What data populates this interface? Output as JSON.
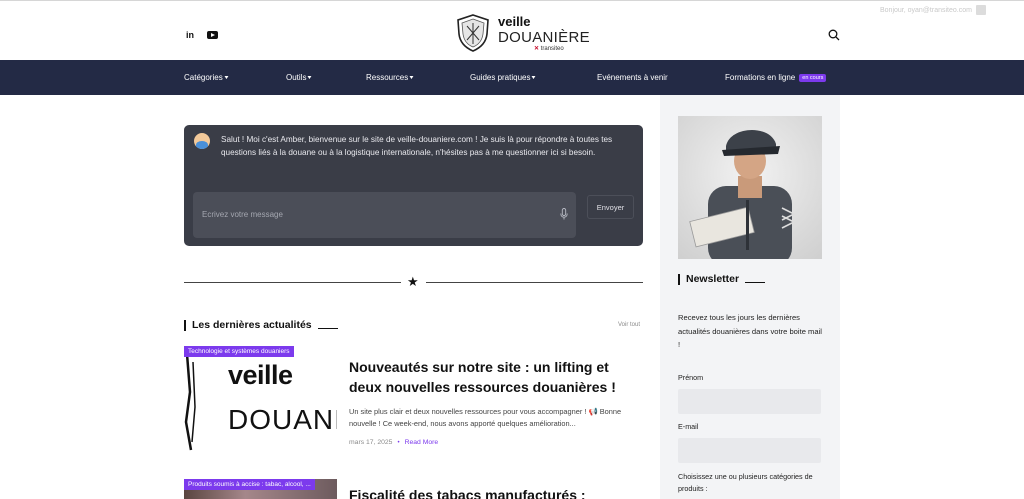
{
  "topbar": {
    "social_icons": [
      "linkedin-icon",
      "youtube-icon"
    ],
    "linkedin_glyph": "in",
    "logo": {
      "word1": "veille",
      "word2": "DOUANIÈRE",
      "by": "transiteo"
    },
    "user_hint": "Bonjour, oyan@transiteo.com"
  },
  "nav": {
    "items": [
      {
        "label": "Catégories",
        "chevron": "▾"
      },
      {
        "label": "Outils",
        "chevron": "▾"
      },
      {
        "label": "Ressources",
        "chevron": "▾"
      },
      {
        "label": "Guides pratiques",
        "chevron": "▾"
      },
      {
        "label": "Evénements à venir"
      },
      {
        "label": "Formations en ligne",
        "badge": "en cours"
      }
    ]
  },
  "chat": {
    "message": "Salut ! Moi c'est Amber, bienvenue sur le site de veille-douaniere.com ! Je suis là pour répondre à toutes tes questions liés à la douane ou à la logistique internationale, n'hésites pas à me questionner ici si besoin.",
    "input_placeholder": "Ecrivez votre message",
    "send_label": "Envoyer"
  },
  "news": {
    "section_title": "Les dernières actualités",
    "see_all": "Voir tout",
    "articles": [
      {
        "category": "Technologie et systèmes douaniers",
        "thumb_word1": "veille",
        "thumb_word2": "DOUANIÈRE",
        "title": "Nouveautés sur notre site : un lifting et deux nouvelles ressources douanières !",
        "excerpt": "Un site plus clair et deux nouvelles ressources pour vous accompagner ! 📢 Bonne nouvelle ! Ce week-end, nous avons apporté quelques amélioration...",
        "date": "mars 17, 2025",
        "read_more": "Read More"
      },
      {
        "category": "Produits soumis à accise : tabac, alcool, ...",
        "title": "Fiscalité des tabacs manufacturés :"
      }
    ]
  },
  "sidebar": {
    "newsletter_title": "Newsletter",
    "newsletter_text": "Recevez tous les jours les dernières actualités douanières dans votre boite mail !",
    "first_name_label": "Prénom",
    "email_label": "E-mail",
    "choose_label": "Choisissez une ou plusieurs catégories de produits :"
  },
  "colors": {
    "nav_bg": "#232a45",
    "accent": "#7c3aed",
    "chat_bg": "#3a3d47",
    "sidebar_bg": "#f3f4f6"
  }
}
